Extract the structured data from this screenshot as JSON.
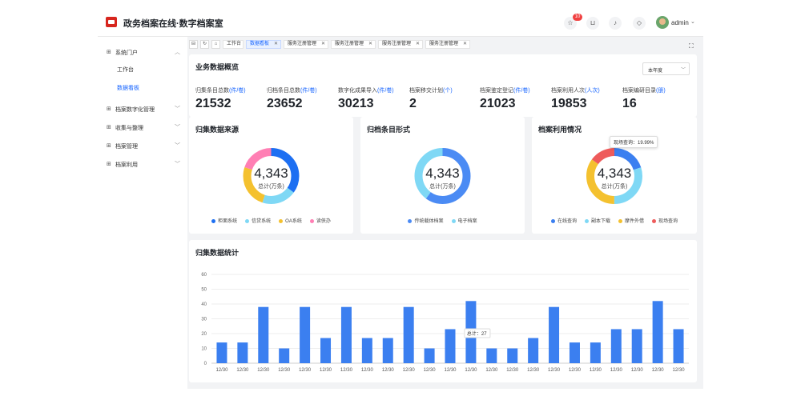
{
  "header": {
    "title": "政务档案在线·数字档案室",
    "notification_count": "10",
    "icons": [
      "star-icon",
      "cart-icon",
      "bell-icon",
      "shield-icon"
    ],
    "user_name": "admin"
  },
  "sidebar": {
    "items": [
      {
        "label": "系统门户",
        "icon": "grid-icon",
        "expanded": true,
        "children": [
          {
            "label": "工作台",
            "active": false
          },
          {
            "label": "数据看板",
            "active": true
          }
        ]
      },
      {
        "label": "档案数字化管理",
        "icon": "grid-icon"
      },
      {
        "label": "收集与整理",
        "icon": "grid-icon"
      },
      {
        "label": "档案管理",
        "icon": "grid-icon"
      },
      {
        "label": "档案利用",
        "icon": "grid-icon"
      }
    ]
  },
  "tabs": [
    {
      "label": "工作台",
      "closable": false,
      "active": false
    },
    {
      "label": "数据看板",
      "closable": true,
      "active": true
    },
    {
      "label": "服务注册管理",
      "closable": true,
      "active": false
    },
    {
      "label": "服务注册管理",
      "closable": true,
      "active": false
    },
    {
      "label": "服务注册管理",
      "closable": true,
      "active": false
    },
    {
      "label": "服务注册管理",
      "closable": true,
      "active": false
    }
  ],
  "overview": {
    "title": "业务数据概览",
    "period": "本年度",
    "stats": [
      {
        "label": "归集条目总数",
        "unit": "(件/卷)",
        "value": "21532"
      },
      {
        "label": "归档条目总数",
        "unit": "(件/卷)",
        "value": "23652"
      },
      {
        "label": "数字化成果导入",
        "unit": "(件/卷)",
        "value": "30213"
      },
      {
        "label": "档案移交计划",
        "unit": "(个)",
        "value": "2"
      },
      {
        "label": "档案鉴定登记",
        "unit": "(件/卷)",
        "value": "21023"
      },
      {
        "label": "档案利用人次",
        "unit": "(人次)",
        "value": "19853"
      },
      {
        "label": "档案编研目录",
        "unit": "(册)",
        "value": "16"
      }
    ]
  },
  "donuts": [
    {
      "title": "归集数据来源",
      "center_value": "4,343",
      "center_label": "总计(万条)",
      "segments": [
        {
          "name": "柜面系统",
          "value": 35,
          "color": "#1d6ff2"
        },
        {
          "name": "信贷系统",
          "value": 20,
          "color": "#7fd8f5"
        },
        {
          "name": "OA系统",
          "value": 25,
          "color": "#f4c12f"
        },
        {
          "name": "读侠办",
          "value": 20,
          "color": "#ff7fb4"
        }
      ]
    },
    {
      "title": "归档条目形式",
      "center_value": "4,343",
      "center_label": "总计(万条)",
      "segments": [
        {
          "name": "传统载体档案",
          "value": 60,
          "color": "#4b8bf4"
        },
        {
          "name": "电子档案",
          "value": 40,
          "color": "#7fd8f5"
        }
      ]
    },
    {
      "title": "档案利用情况",
      "center_value": "4,343",
      "center_label": "总计(万条)",
      "tooltip": "现场查询：19.99%",
      "segments": [
        {
          "name": "在线查询",
          "value": 20,
          "color": "#3b7ff0"
        },
        {
          "name": "副本下载",
          "value": 30,
          "color": "#7fd8f5"
        },
        {
          "name": "摩件外借",
          "value": 35,
          "color": "#f4c12f"
        },
        {
          "name": "现场查询",
          "value": 15,
          "color": "#ee5b5b"
        }
      ]
    }
  ],
  "chart_data": {
    "type": "bar",
    "title": "归集数据统计",
    "categories": [
      "12/30",
      "12/30",
      "12/30",
      "12/30",
      "12/30",
      "12/30",
      "12/30",
      "12/30",
      "12/30",
      "12/30",
      "12/30",
      "12/30",
      "12/30",
      "12/30",
      "12/30",
      "12/30",
      "12/30",
      "12/30",
      "12/30",
      "12/30",
      "12/30",
      "12/30",
      "12/30",
      "12/30",
      "12/30",
      "12/30"
    ],
    "values": [
      14,
      14,
      38,
      10,
      38,
      17,
      38,
      17,
      17,
      38,
      10,
      23,
      42,
      10,
      10,
      17,
      38,
      14,
      14,
      23,
      23,
      42,
      23
    ],
    "ylim": [
      0,
      60
    ],
    "yticks": [
      0,
      10,
      20,
      30,
      40,
      50,
      60
    ],
    "grid": true,
    "color": "#3b7ff0",
    "tooltip": "总计：27"
  }
}
